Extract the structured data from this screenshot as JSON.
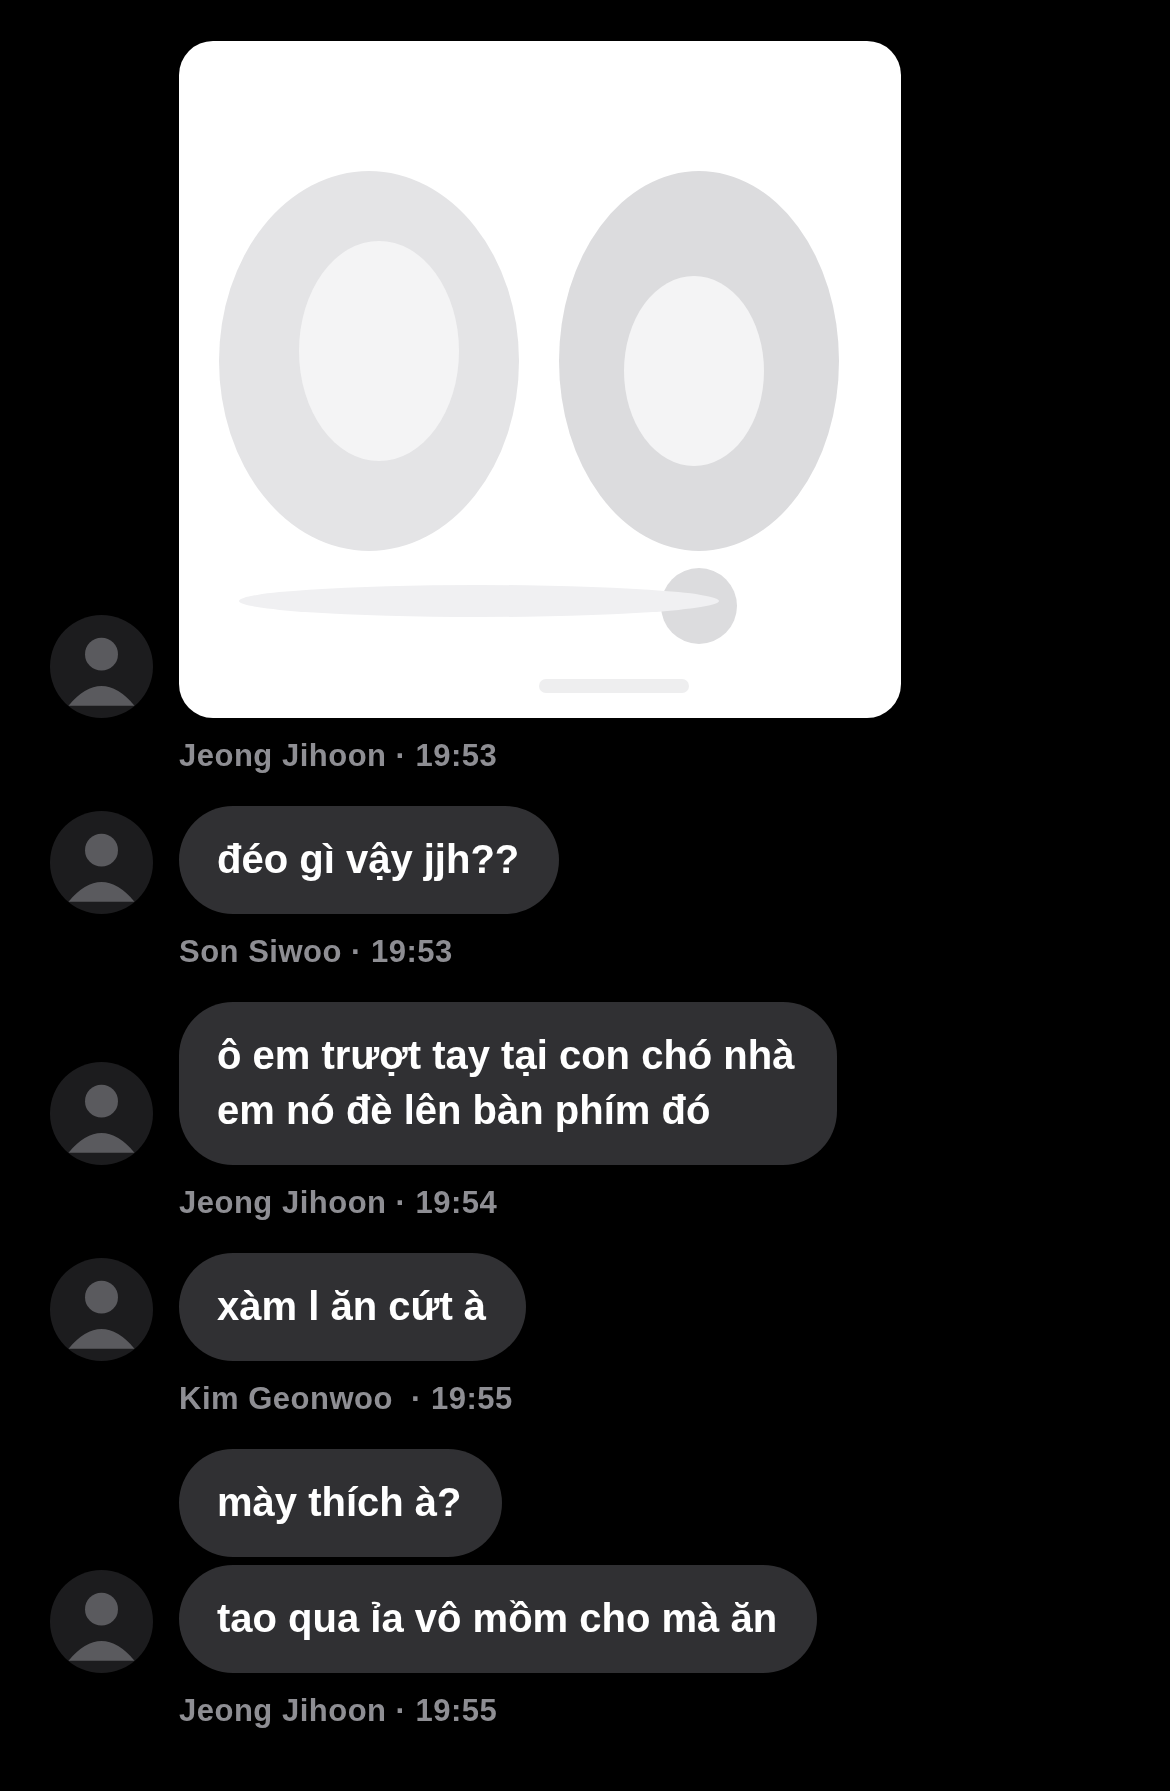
{
  "groups": [
    {
      "meta": "Jeong Jihoon · 19:53"
    },
    {
      "messages": [
        {
          "kind": "text",
          "text": "đéo gì vậy jjh??"
        }
      ],
      "meta": "Son Siwoo · 19:53"
    },
    {
      "messages": [
        {
          "kind": "text",
          "text": "ô em trượt tay tại con chó nhà em nó đè lên bàn phím đó"
        }
      ],
      "meta": "Jeong Jihoon · 19:54"
    },
    {
      "messages": [
        {
          "kind": "text",
          "text": "xàm l ăn cứt à"
        }
      ],
      "meta": "Kim Geonwoo  · 19:55"
    },
    {
      "messages": [
        {
          "kind": "text",
          "text": "mày thích à?"
        },
        {
          "kind": "text",
          "text": "tao qua ỉa vô mồm cho mà ăn"
        }
      ],
      "meta": "Jeong Jihoon · 19:55"
    }
  ]
}
